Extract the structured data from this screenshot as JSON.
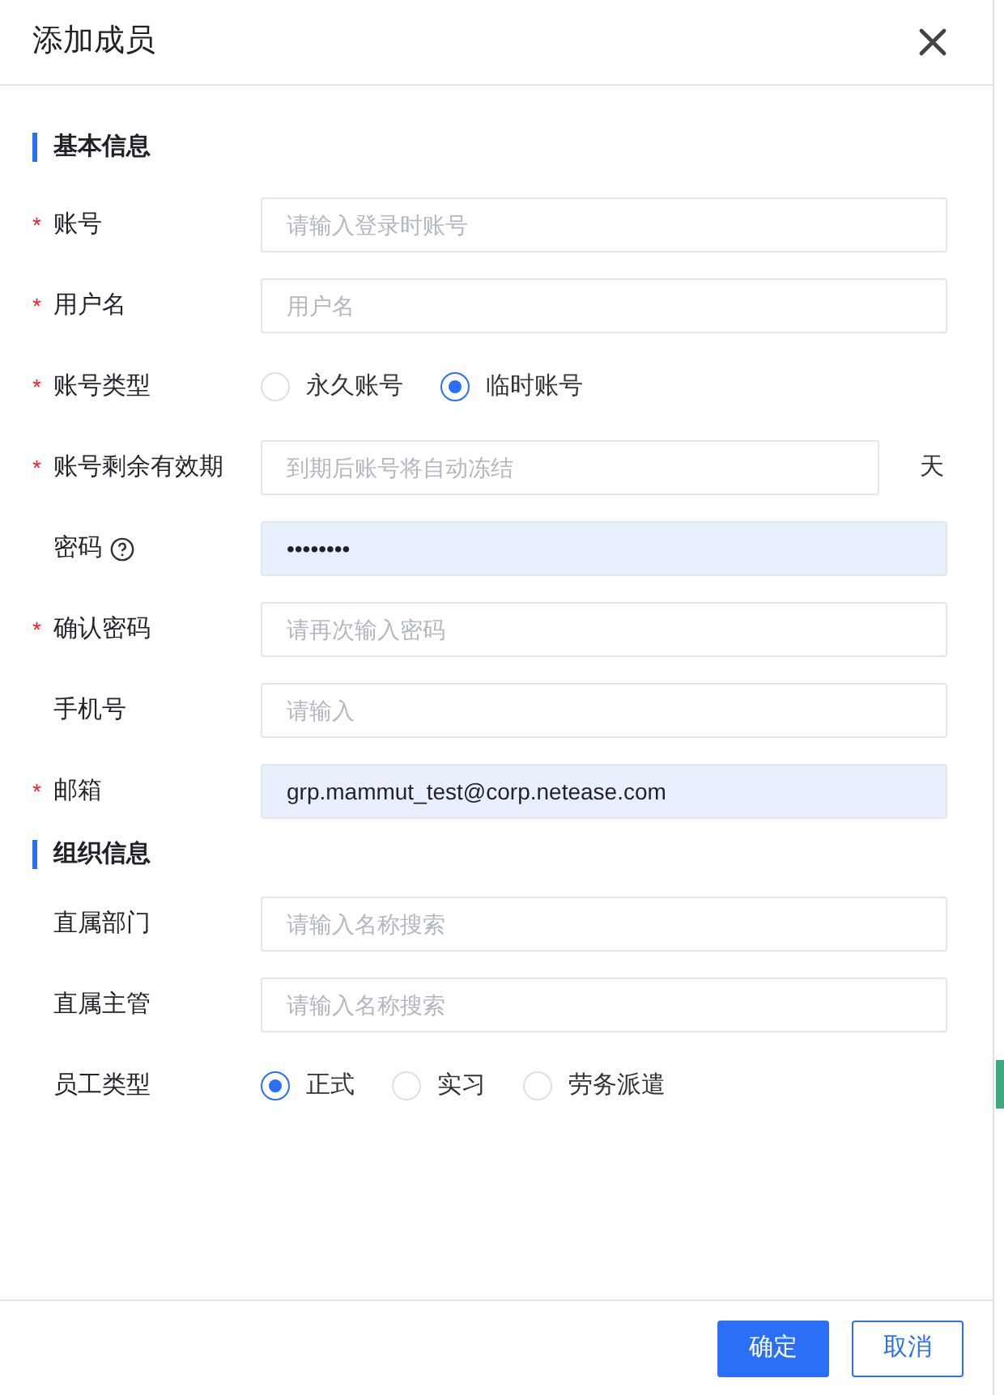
{
  "dialog": {
    "title": "添加成员"
  },
  "sections": [
    {
      "title": "基本信息",
      "fields": [
        {
          "kind": "text",
          "label": "账号",
          "required_mark": "*",
          "placeholder": "请输入登录时账号"
        },
        {
          "kind": "text",
          "label": "用户名",
          "required_mark": "*",
          "placeholder": "用户名"
        },
        {
          "kind": "radio",
          "label": "账号类型",
          "required_mark": "*",
          "options": [
            {
              "label": "永久账号",
              "selected": false
            },
            {
              "label": "临时账号",
              "selected": true
            }
          ]
        },
        {
          "kind": "text",
          "label": "账号剩余有效期",
          "required_mark": "*",
          "placeholder": "到期后账号将自动冻结",
          "suffix": "天"
        },
        {
          "kind": "text",
          "label": "密码",
          "help": true,
          "value": "••••••••",
          "autofilled": true
        },
        {
          "kind": "text",
          "label": "确认密码",
          "required_mark": "*",
          "placeholder": "请再次输入密码"
        },
        {
          "kind": "text",
          "label": "手机号",
          "placeholder": "请输入"
        },
        {
          "kind": "text",
          "label": "邮箱",
          "required_mark": "*",
          "value": "grp.mammut_test@corp.netease.com",
          "autofilled": true
        }
      ]
    },
    {
      "title": "组织信息",
      "fields": [
        {
          "kind": "text",
          "label": "直属部门",
          "placeholder": "请输入名称搜索"
        },
        {
          "kind": "text",
          "label": "直属主管",
          "placeholder": "请输入名称搜索"
        },
        {
          "kind": "radio",
          "label": "员工类型",
          "options": [
            {
              "label": "正式",
              "selected": true
            },
            {
              "label": "实习",
              "selected": false
            },
            {
              "label": "劳务派遣",
              "selected": false
            }
          ]
        }
      ]
    }
  ],
  "buttons": [
    {
      "label": "确定",
      "kind": "primary"
    },
    {
      "label": "取消",
      "kind": "secondary"
    }
  ]
}
